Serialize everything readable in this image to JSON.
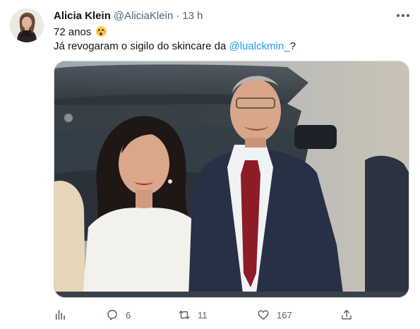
{
  "author": {
    "name": "Alicia Klein",
    "handle": "@AliciaKlein",
    "separator": "·",
    "time": "13 h"
  },
  "tweet": {
    "line1_text": "72 anos",
    "line1_emoji": "flushed-face-emoji",
    "line2_prefix": "Já revogaram o sigilo do skincare da ",
    "mention": "@lualckmin_",
    "line2_suffix": "?"
  },
  "media": {
    "description_icon": "photo"
  },
  "actions": {
    "replies": "6",
    "retweets": "11",
    "likes": "167",
    "icons": [
      "analytics-icon",
      "reply-icon",
      "retweet-icon",
      "like-icon",
      "share-icon"
    ]
  },
  "colors": {
    "text": "#0f1419",
    "secondary": "#536471",
    "link": "#1d9bf0",
    "border": "#cfd9de"
  }
}
